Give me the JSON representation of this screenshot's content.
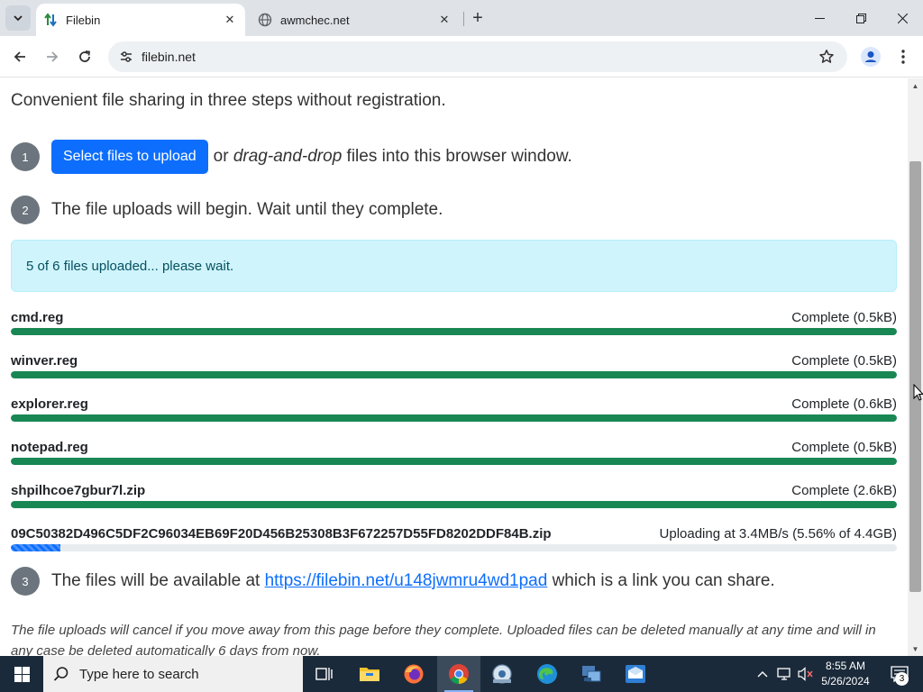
{
  "browser": {
    "tabs": [
      {
        "title": "Filebin",
        "active": true,
        "icon": "filebin-arrows-icon"
      },
      {
        "title": "awmchec.net",
        "active": false,
        "icon": "globe-icon"
      }
    ],
    "url": "filebin.net"
  },
  "page": {
    "intro": "Convenient file sharing in three steps without registration.",
    "step1": {
      "number": "1",
      "button": "Select files to upload",
      "text_pre": "or",
      "text_em": "drag-and-drop",
      "text_post": "files into this browser window."
    },
    "step2": {
      "number": "2",
      "text": "The file uploads will begin. Wait until they complete."
    },
    "alert": "5 of 6 files uploaded... please wait.",
    "files": [
      {
        "name": "cmd.reg",
        "status": "Complete (0.5kB)",
        "progress": 1.0,
        "state": "complete"
      },
      {
        "name": "winver.reg",
        "status": "Complete (0.5kB)",
        "progress": 1.0,
        "state": "complete"
      },
      {
        "name": "explorer.reg",
        "status": "Complete (0.6kB)",
        "progress": 1.0,
        "state": "complete"
      },
      {
        "name": "notepad.reg",
        "status": "Complete (0.5kB)",
        "progress": 1.0,
        "state": "complete"
      },
      {
        "name": "shpilhcoe7gbur7l.zip",
        "status": "Complete (2.6kB)",
        "progress": 1.0,
        "state": "complete"
      },
      {
        "name": "09C50382D496C5DF2C96034EB69F20D456B25308B3F672257D55FD8202DDF84B.zip",
        "status": "Uploading at 3.4MB/s (5.56% of 4.4GB)",
        "progress": 0.0556,
        "state": "uploading"
      }
    ],
    "step3": {
      "number": "3",
      "text_pre": "The files will be available at",
      "link": "https://filebin.net/u148jwmru4wd1pad",
      "text_post": "which is a link you can share."
    },
    "note": "The file uploads will cancel if you move away from this page before they complete. Uploaded files can be deleted manually at any time and will in any case be deleted automatically 6 days from now."
  },
  "taskbar": {
    "search_placeholder": "Type here to search",
    "time": "8:55 AM",
    "date": "5/26/2024",
    "notification_count": "3"
  },
  "colors": {
    "primary": "#0d6efd",
    "success": "#198754",
    "alert_bg": "#cff4fc",
    "badge": "#6c757d"
  }
}
